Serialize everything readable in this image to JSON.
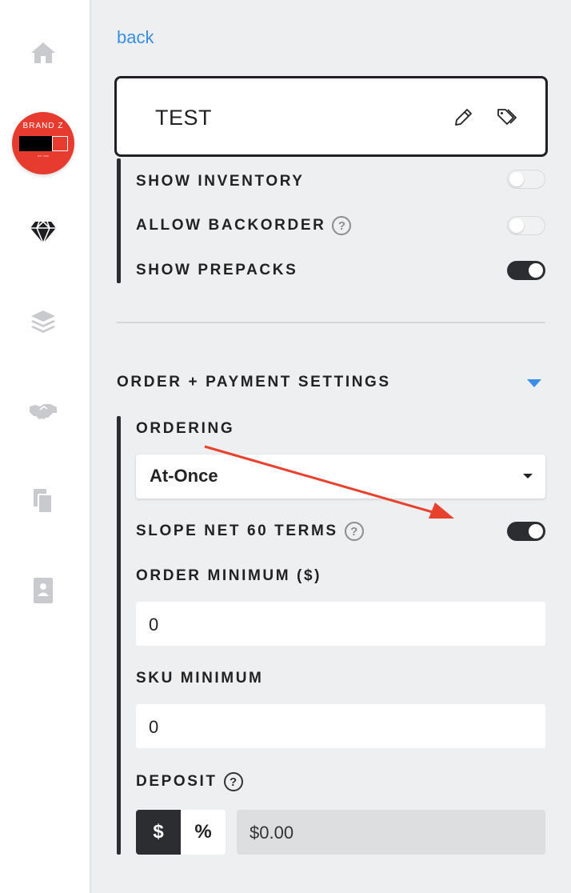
{
  "sidebar": {
    "items": [
      {
        "name": "home-icon"
      },
      {
        "name": "brand-logo"
      },
      {
        "name": "diamond-icon"
      },
      {
        "name": "layers-icon"
      },
      {
        "name": "handshake-icon"
      },
      {
        "name": "documents-icon"
      },
      {
        "name": "contact-card-icon"
      }
    ],
    "brand": {
      "text": "BRAND Z",
      "sub": "EST. 2020"
    }
  },
  "header": {
    "back_label": "back",
    "title": "TEST"
  },
  "inventory": {
    "show_inventory": {
      "label": "SHOW INVENTORY",
      "on": false
    },
    "allow_backorder": {
      "label": "ALLOW BACKORDER",
      "on": false
    },
    "show_prepacks": {
      "label": "SHOW PREPACKS",
      "on": true
    }
  },
  "order_payment": {
    "section_title": "ORDER + PAYMENT SETTINGS",
    "ordering_label": "ORDERING",
    "ordering_value": "At-Once",
    "slope_label": "SLOPE NET 60 TERMS",
    "slope_on": true,
    "order_min_label": "ORDER MINIMUM ($)",
    "order_min_value": "0",
    "sku_min_label": "SKU MINIMUM",
    "sku_min_value": "0",
    "deposit_label": "DEPOSIT",
    "deposit_mode_dollar": "$",
    "deposit_mode_percent": "%",
    "deposit_value": "$0.00"
  },
  "help_glyph": "?",
  "colors": {
    "accent": "#3a8ee6",
    "dark": "#2b2d31",
    "brand_red": "#e63b2e",
    "annotation_arrow": "#e8412c"
  }
}
